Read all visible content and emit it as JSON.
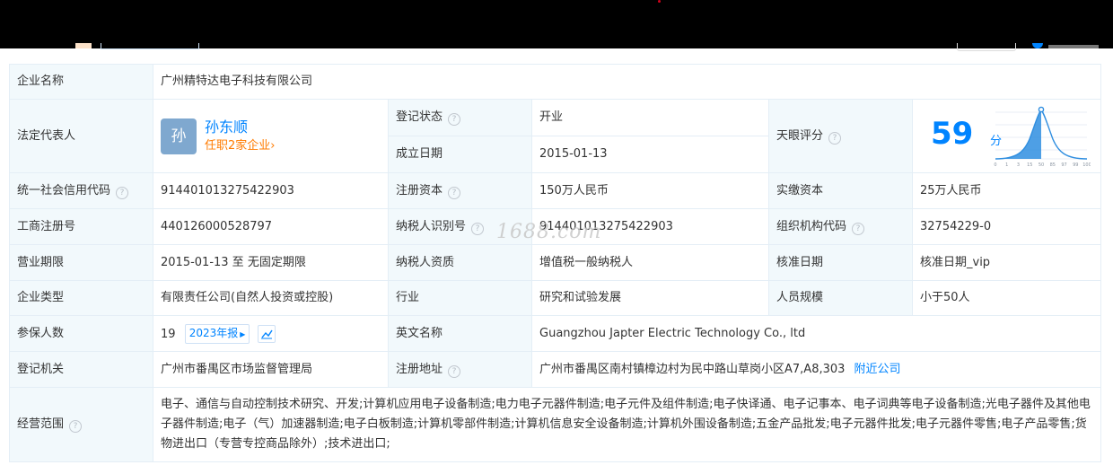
{
  "company": {
    "name_label": "企业名称",
    "name_value": "广州精特达电子科技有限公司",
    "legal_rep_label": "法定代表人",
    "legal_rep_avatar": "孙",
    "legal_rep_name": "孙东顺",
    "legal_rep_sub": "任职2家企业",
    "reg_status_label": "登记状态",
    "reg_status_value": "开业",
    "found_date_label": "成立日期",
    "found_date_value": "2015-01-13",
    "score_label": "天眼评分",
    "score_value": "59",
    "score_unit": "分",
    "credit_code_label": "统一社会信用代码",
    "credit_code_value": "914401013275422903",
    "reg_capital_label": "注册资本",
    "reg_capital_value": "150万人民币",
    "paid_capital_label": "实缴资本",
    "paid_capital_value": "25万人民币",
    "biz_reg_no_label": "工商注册号",
    "biz_reg_no_value": "440126000528797",
    "taxpayer_id_label": "纳税人识别号",
    "taxpayer_id_value": "914401013275422903",
    "org_code_label": "组织机构代码",
    "org_code_value": "32754229-0",
    "term_label": "营业期限",
    "term_value": "2015-01-13 至 无固定期限",
    "taxpayer_qual_label": "纳税人资质",
    "taxpayer_qual_value": "增值税一般纳税人",
    "approval_date_label": "核准日期",
    "approval_date_value": "核准日期_vip",
    "type_label": "企业类型",
    "type_value": "有限责任公司(自然人投资或控股)",
    "industry_label": "行业",
    "industry_value": "研究和试验发展",
    "staff_size_label": "人员规模",
    "staff_size_value": "小于50人",
    "insured_label": "参保人数",
    "insured_value": "19",
    "insured_report": "2023年报",
    "english_name_label": "英文名称",
    "english_name_value": "Guangzhou Japter Electric Technology Co., ltd",
    "authority_label": "登记机关",
    "authority_value": "广州市番禺区市场监督管理局",
    "address_label": "注册地址",
    "address_value": "广州市番禺区南村镇樟边村为民中路山草岗小区A7,A8,303",
    "nearby_link": "附近公司",
    "scope_label": "经营范围",
    "scope_value": "电子、通信与自动控制技术研究、开发;计算机应用电子设备制造;电力电子元器件制造;电子元件及组件制造;电子快译通、电子记事本、电子词典等电子设备制造;光电子器件及其他电子器件制造;电子（气）加速器制造;电子白板制造;计算机零部件制造;计算机信息安全设备制造;计算机外围设备制造;五金产品批发;电子元器件批发;电子元器件零售;电子产品零售;货物进出口（专营专控商品除外）;技术进出口;"
  },
  "score_chart": {
    "ticks": [
      "0",
      "1",
      "3",
      "15",
      "50",
      "85",
      "97",
      "99",
      "100"
    ]
  },
  "watermark": "1688.com",
  "colors": {
    "accent": "#0084ff",
    "label_bg": "#f2f9fc",
    "status_green": "#00a854",
    "orange": "#ff7b00"
  }
}
